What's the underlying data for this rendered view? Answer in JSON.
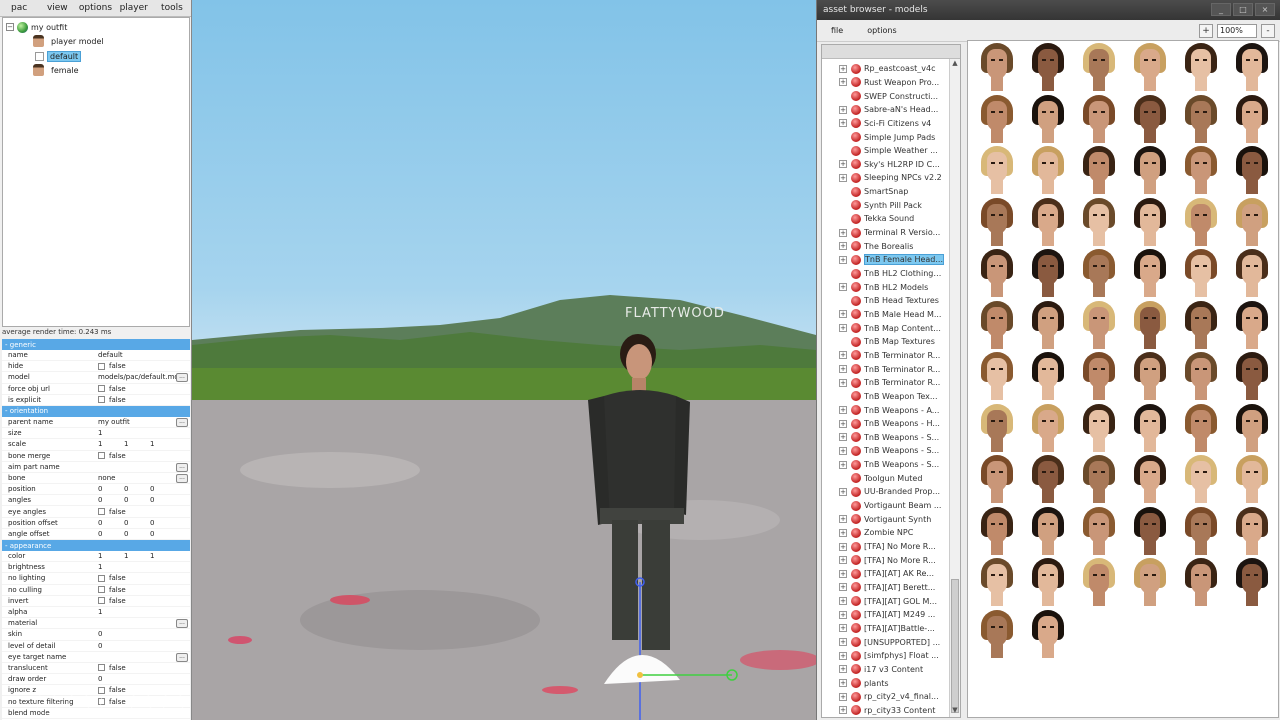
{
  "pac_editor": {
    "menu": [
      "pac",
      "view",
      "options",
      "player",
      "tools"
    ],
    "tree": [
      {
        "label": "my outfit",
        "icon": "globe-icon"
      },
      {
        "label": "player model",
        "icon": "face-icon"
      },
      {
        "label": "default",
        "icon": "leaf-icon",
        "selected": true
      },
      {
        "label": "female",
        "icon": "face-icon"
      }
    ],
    "render_time": "average render time: 0.243 ms",
    "sections": {
      "generic": "generic",
      "orientation": "orientation",
      "appearance": "appearance"
    },
    "props_generic": [
      {
        "key": "name",
        "value": "default"
      },
      {
        "key": "hide",
        "value": "false",
        "checkbox": true
      },
      {
        "key": "model",
        "value": "models/pac/default.mdl",
        "dots": true
      },
      {
        "key": "force obj url",
        "value": "false",
        "checkbox": true
      },
      {
        "key": "is explicit",
        "value": "false",
        "checkbox": true
      }
    ],
    "props_orientation": [
      {
        "key": "parent name",
        "value": "my outfit",
        "dots": true
      },
      {
        "key": "size",
        "value": "1"
      },
      {
        "key": "scale",
        "v3": [
          "1",
          "1",
          "1"
        ]
      },
      {
        "key": "bone merge",
        "value": "false",
        "checkbox": true
      },
      {
        "key": "aim part name",
        "value": "",
        "dots": true
      },
      {
        "key": "bone",
        "value": "none",
        "dots": true
      },
      {
        "key": "position",
        "v3": [
          "0",
          "0",
          "0"
        ]
      },
      {
        "key": "angles",
        "v3": [
          "0",
          "0",
          "0"
        ]
      },
      {
        "key": "eye angles",
        "value": "false",
        "checkbox": true
      },
      {
        "key": "position offset",
        "v3": [
          "0",
          "0",
          "0"
        ]
      },
      {
        "key": "angle offset",
        "v3": [
          "0",
          "0",
          "0"
        ]
      }
    ],
    "props_appearance": [
      {
        "key": "color",
        "v3": [
          "1",
          "1",
          "1"
        ]
      },
      {
        "key": "brightness",
        "value": "1"
      },
      {
        "key": "no lighting",
        "value": "false",
        "checkbox": true
      },
      {
        "key": "no culling",
        "value": "false",
        "checkbox": true
      },
      {
        "key": "invert",
        "value": "false",
        "checkbox": true
      },
      {
        "key": "alpha",
        "value": "1"
      },
      {
        "key": "material",
        "value": "",
        "dots": true
      },
      {
        "key": "skin",
        "value": "0"
      },
      {
        "key": "level of detail",
        "value": "0"
      },
      {
        "key": "eye target name",
        "value": "",
        "dots": true
      },
      {
        "key": "translucent",
        "value": "false",
        "checkbox": true
      },
      {
        "key": "draw order",
        "value": "0"
      },
      {
        "key": "ignore z",
        "value": "false",
        "checkbox": true
      },
      {
        "key": "no texture filtering",
        "value": "false",
        "checkbox": true
      },
      {
        "key": "blend mode",
        "value": ""
      }
    ]
  },
  "viewport": {
    "sign_text": "FLATTYWOOD"
  },
  "asset_browser": {
    "title": "asset browser - models",
    "window_buttons": [
      "_",
      "□",
      "×"
    ],
    "menu": [
      "file",
      "options"
    ],
    "zoom_in": "+",
    "zoom_value": "100%",
    "zoom_out": "-",
    "items": [
      {
        "label": "Rp_eastcoast_v4c",
        "exp": true
      },
      {
        "label": "Rust Weapon Pro...",
        "exp": true
      },
      {
        "label": "SWEP Constructi...",
        "exp": false
      },
      {
        "label": "Sabre-aN's Head...",
        "exp": true
      },
      {
        "label": "Sci-Fi Citizens v4",
        "exp": true
      },
      {
        "label": "Simple Jump Pads",
        "exp": false
      },
      {
        "label": "Simple Weather ...",
        "exp": false
      },
      {
        "label": "Sky's HL2RP ID C...",
        "exp": true
      },
      {
        "label": "Sleeping NPCs v2.2",
        "exp": true
      },
      {
        "label": "SmartSnap",
        "exp": false
      },
      {
        "label": "Synth Pill Pack",
        "exp": false
      },
      {
        "label": "Tekka Sound",
        "exp": false
      },
      {
        "label": "Terminal R Versio...",
        "exp": true
      },
      {
        "label": "The Borealis",
        "exp": true
      },
      {
        "label": "TnB Female Head...",
        "exp": true,
        "selected": true
      },
      {
        "label": "TnB HL2 Clothing ...",
        "exp": false
      },
      {
        "label": "TnB HL2 Models",
        "exp": true
      },
      {
        "label": "TnB Head Textures",
        "exp": false
      },
      {
        "label": "TnB Male Head M...",
        "exp": true
      },
      {
        "label": "TnB Map Content...",
        "exp": true
      },
      {
        "label": "TnB Map Textures",
        "exp": false
      },
      {
        "label": "TnB Terminator R...",
        "exp": true
      },
      {
        "label": "TnB Terminator R...",
        "exp": true
      },
      {
        "label": "TnB Terminator R...",
        "exp": true
      },
      {
        "label": "TnB Weapon Tex...",
        "exp": false
      },
      {
        "label": "TnB Weapons - A...",
        "exp": true
      },
      {
        "label": "TnB Weapons - H...",
        "exp": true
      },
      {
        "label": "TnB Weapons - S...",
        "exp": true
      },
      {
        "label": "TnB Weapons - S...",
        "exp": true
      },
      {
        "label": "TnB Weapons - S...",
        "exp": true
      },
      {
        "label": "Toolgun Muted",
        "exp": false
      },
      {
        "label": "UU-Branded Prop...",
        "exp": true
      },
      {
        "label": "Vortigaunt Beam ...",
        "exp": false
      },
      {
        "label": "Vortigaunt Synth",
        "exp": true
      },
      {
        "label": "Zombie NPC",
        "exp": true
      },
      {
        "label": "[TFA] No More R...",
        "exp": true
      },
      {
        "label": "[TFA] No More R...",
        "exp": true
      },
      {
        "label": "[TFA][AT] AK Re...",
        "exp": true
      },
      {
        "label": "[TFA][AT] Berett...",
        "exp": true
      },
      {
        "label": "[TFA][AT] GOL M...",
        "exp": true
      },
      {
        "label": "[TFA][AT] M249 ...",
        "exp": true
      },
      {
        "label": "[TFA][AT]Battle-...",
        "exp": true
      },
      {
        "label": "[UNSUPPORTED] ...",
        "exp": true
      },
      {
        "label": "[simfphys] Float ...",
        "exp": true
      },
      {
        "label": "i17 v3 Content",
        "exp": true
      },
      {
        "label": "plants",
        "exp": true
      },
      {
        "label": "rp_city2_v4_final...",
        "exp": true
      },
      {
        "label": "rp_city33 Content",
        "exp": true
      }
    ],
    "thumbnail_count": 68
  }
}
